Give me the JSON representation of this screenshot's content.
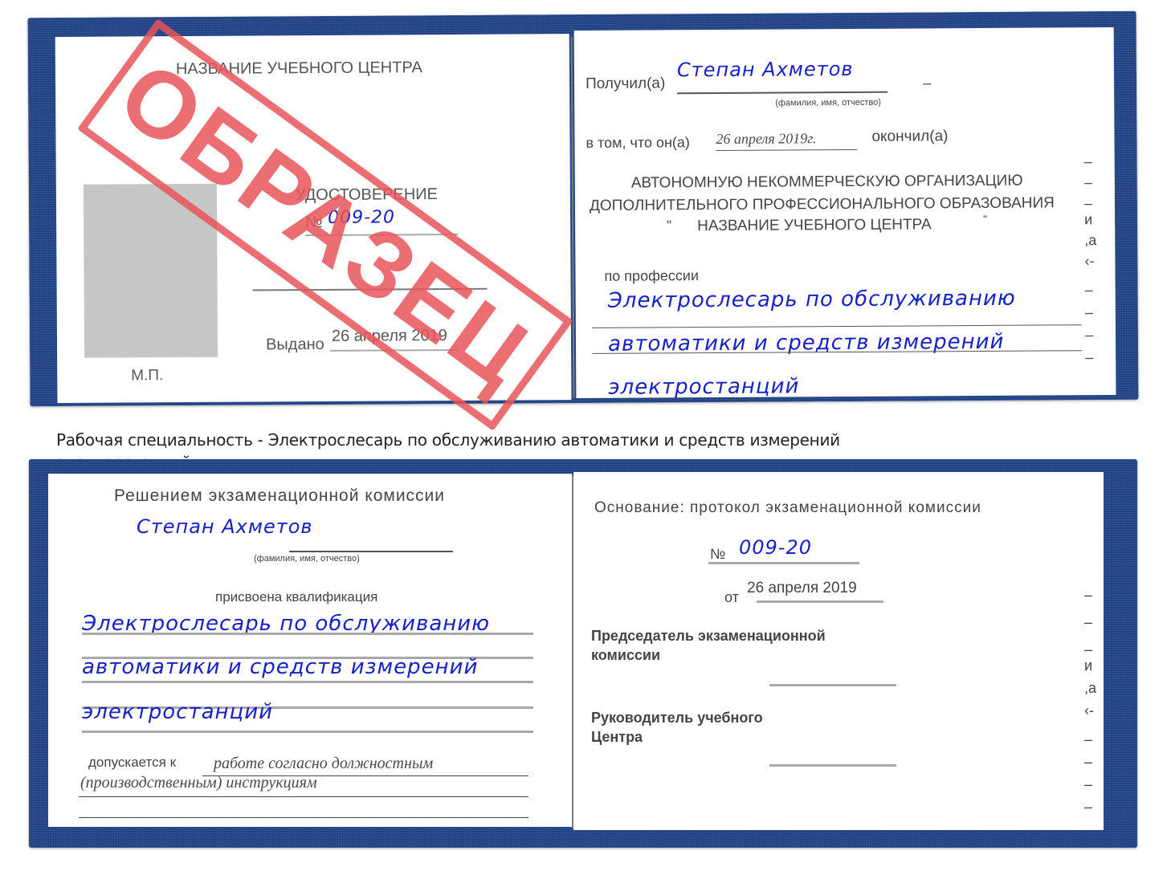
{
  "top_booklet": {
    "left_page": {
      "center_name": "НАЗВАНИЕ УЧЕБНОГО ЦЕНТРА",
      "doc_title": "УДОСТОВЕРЕНИЕ",
      "number_label": "№",
      "number_value": "009-20",
      "issued_label": "Выдано",
      "issued_date": "26 апреля 2019",
      "seal_label": "М.П.",
      "photo_placeholder": "photo"
    },
    "right_page": {
      "received_label": "Получил(а)",
      "recipient_name": "Степан Ахметов",
      "name_hint": "(фамилия, имя, отчество)",
      "dash": "–",
      "that_label": "в том, что он(а)",
      "completion_date": "26 апреля 2019г.",
      "completed_label": "окончил(а)",
      "org_line1": "АВТОНОМНУЮ НЕКОММЕРЧЕСКУЮ ОРГАНИЗАЦИЮ",
      "org_line2": "ДОПОЛНИТЕЛЬНОГО ПРОФЕССИОНАЛЬНОГО ОБРАЗОВАНИЯ",
      "org_line3_open_quote": "\"",
      "org_line3": "НАЗВАНИЕ УЧЕБНОГО ЦЕНТРА",
      "org_line3_close_quote": "\"",
      "profession_label": "по профессии",
      "profession_lines": [
        "Электрослесарь по обслуживанию",
        "автоматики и средств измерений",
        "электростанций"
      ],
      "edge_marks": [
        "–",
        "–",
        "–",
        "и",
        ",а",
        "‹-",
        "–",
        "–",
        "–",
        "–"
      ]
    }
  },
  "stamp": {
    "text": "ОБРАЗЕЦ",
    "color": "#e8555a"
  },
  "caption": "Рабочая специальность - Электрослесарь по обслуживанию автоматики и средств измерений электростанций",
  "bottom_booklet": {
    "left_page": {
      "decision_title": "Решением экзаменационной комиссии",
      "person_name": "Степан Ахметов",
      "name_hint": "(фамилия, имя, отчество)",
      "qualification_label": "присвоена квалификация",
      "qualification_lines": [
        "Электрослесарь по обслуживанию",
        "автоматики и средств измерений",
        "электростанций"
      ],
      "admitted_label": "допускается к",
      "admitted_line1": "работе согласно должностным",
      "admitted_line2": "(производственным) инструкциям"
    },
    "right_page": {
      "basis_title": "Основание: протокол экзаменационной комиссии",
      "number_label": "№",
      "number_value": "009-20",
      "from_label": "от",
      "protocol_date": "26 апреля 2019",
      "chairman_line1": "Председатель экзаменационной",
      "chairman_line2": "комиссии",
      "head_line1": "Руководитель учебного",
      "head_line2": "Центра",
      "edge_marks": [
        "–",
        "–",
        "–",
        "и",
        ",а",
        "‹-",
        "–",
        "–",
        "–",
        "–"
      ]
    }
  },
  "colors": {
    "cover_blue": "#23458a",
    "ink_blue": "#1521c8",
    "print_gray": "#4a4a4a",
    "stamp_red": "#e8555a"
  }
}
